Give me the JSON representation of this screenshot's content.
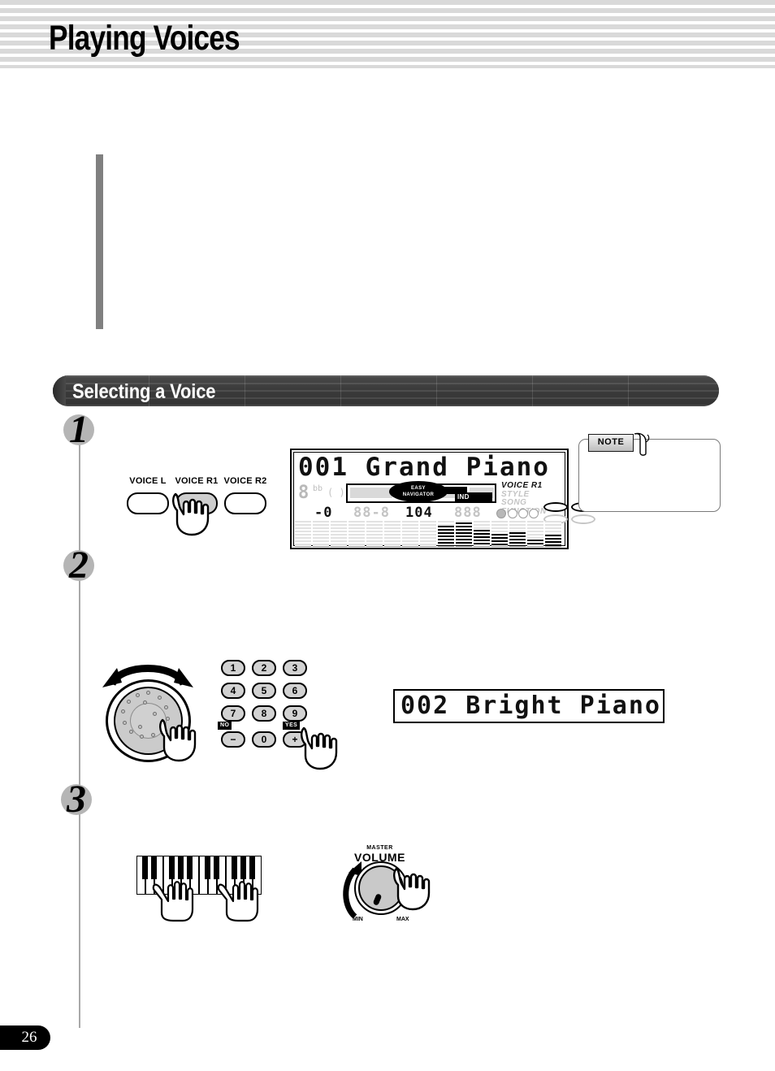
{
  "header": {
    "title": "Playing Voices"
  },
  "section": {
    "title": "Selecting a Voice"
  },
  "steps": {
    "one": "1",
    "two": "2",
    "three": "3"
  },
  "voice_buttons": {
    "left": "VOICE L",
    "right1": "VOICE R1",
    "right2": "VOICE R2",
    "pressed": "VOICE R1"
  },
  "lcd_main": {
    "voice_name": "001 Grand Piano",
    "big_char": "8",
    "superscript": "bb",
    "paren": "( )",
    "easy_navigator_line1": "EASY",
    "easy_navigator_line2": "NAVIGATOR",
    "no_indicator": "IND",
    "modes": {
      "voice": "VOICE",
      "part": "R1",
      "style": "STYLE",
      "song": "SONG",
      "function": "FUNCTION"
    },
    "numbers": {
      "transpose": "-0",
      "tempo": "88-8",
      "measure": "104",
      "beat": "888"
    }
  },
  "note_box": {
    "label": "NOTE",
    "body": ""
  },
  "lcd_second": {
    "voice_name": "002 Bright Piano"
  },
  "keypad": {
    "keys": [
      "1",
      "2",
      "3",
      "4",
      "5",
      "6",
      "7",
      "8",
      "9",
      "−",
      "0",
      "+"
    ],
    "no_label": "NO",
    "yes_label": "YES"
  },
  "volume": {
    "label_top": "MASTER",
    "label_main": "VOLUME",
    "min": "MIN",
    "max": "MAX"
  },
  "page": {
    "number": "26"
  },
  "colors": {
    "header_stripe": "#d9d9d9",
    "section_bar": "#3a3a3a",
    "step_disc": "#b5b5b5",
    "rail": "#a9a9a9",
    "intro_bar": "#808080",
    "page_tab": "#000000"
  }
}
